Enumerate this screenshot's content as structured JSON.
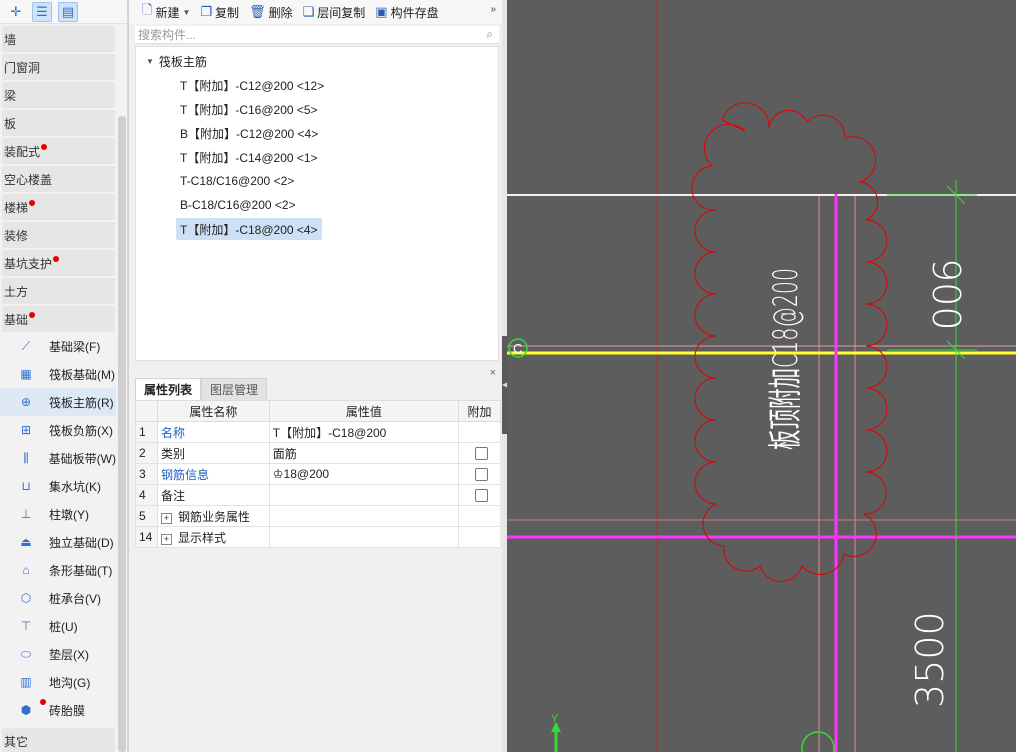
{
  "left_panel": {
    "top_buttons": [
      "cursor-plus-icon",
      "list-view-icon",
      "detail-view-icon"
    ],
    "categories_top": [
      {
        "label": "墙",
        "dot": false
      },
      {
        "label": "门窗洞",
        "dot": false
      },
      {
        "label": "梁",
        "dot": false
      },
      {
        "label": "板",
        "dot": false
      },
      {
        "label": "装配式",
        "dot": true
      },
      {
        "label": "空心楼盖",
        "dot": false
      },
      {
        "label": "楼梯",
        "dot": true
      },
      {
        "label": "装修",
        "dot": false
      },
      {
        "label": "基坑支护",
        "dot": true
      },
      {
        "label": "土方",
        "dot": false
      },
      {
        "label": "基础",
        "dot": true
      }
    ],
    "sub_items": [
      {
        "label": "基础梁(F)",
        "icon": "foundation-beam-icon"
      },
      {
        "label": "筏板基础(M)",
        "icon": "raft-foundation-icon"
      },
      {
        "label": "筏板主筋(R)",
        "icon": "raft-main-rebar-icon"
      },
      {
        "label": "筏板负筋(X)",
        "icon": "raft-negative-rebar-icon"
      },
      {
        "label": "基础板带(W)",
        "icon": "foundation-strip-icon"
      },
      {
        "label": "集水坑(K)",
        "icon": "sump-pit-icon"
      },
      {
        "label": "柱墩(Y)",
        "icon": "column-pier-icon"
      },
      {
        "label": "独立基础(D)",
        "icon": "isolated-footing-icon"
      },
      {
        "label": "条形基础(T)",
        "icon": "strip-footing-icon"
      },
      {
        "label": "桩承台(V)",
        "icon": "pile-cap-icon"
      },
      {
        "label": "桩(U)",
        "icon": "pile-icon"
      },
      {
        "label": "垫层(X)",
        "icon": "cushion-layer-icon"
      },
      {
        "label": "地沟(G)",
        "icon": "trench-icon"
      },
      {
        "label": "砖胎膜",
        "icon": "brick-formwork-icon"
      }
    ],
    "categories_bottom": [
      {
        "label": "其它",
        "dot": false
      }
    ]
  },
  "toolbar": {
    "new_label": "新建",
    "copy_label": "复制",
    "delete_label": "删除",
    "floor_copy_label": "层间复制",
    "save_label": "构件存盘",
    "more": "»"
  },
  "search": {
    "placeholder": "搜索构件..."
  },
  "tree": {
    "root": "筏板主筋",
    "items": [
      "T【附加】-C12@200 <12>",
      "T【附加】-C16@200 <5>",
      "B【附加】-C12@200 <4>",
      "T【附加】-C14@200 <1>",
      "T-C18/C16@200 <2>",
      "B-C18/C16@200 <2>",
      "T【附加】-C18@200 <4>"
    ],
    "selected_index": 6
  },
  "properties": {
    "tabs": [
      "属性列表",
      "图层管理"
    ],
    "headers": [
      "属性名称",
      "属性值",
      "附加"
    ],
    "close": "×",
    "rows": [
      {
        "num": "1",
        "name": "名称",
        "value": "T【附加】-C18@200",
        "checkbox": false,
        "blue": true
      },
      {
        "num": "2",
        "name": "类别",
        "value": "面筋",
        "checkbox": true,
        "blue": false
      },
      {
        "num": "3",
        "name": "钢筋信息",
        "value": "♔18@200",
        "checkbox": true,
        "blue": true
      },
      {
        "num": "4",
        "name": "备注",
        "value": "",
        "checkbox": true,
        "blue": false
      },
      {
        "num": "5",
        "name": "钢筋业务属性",
        "value": "",
        "checkbox": false,
        "blue": false,
        "expander": "+"
      },
      {
        "num": "14",
        "name": "显示样式",
        "value": "",
        "checkbox": false,
        "blue": false,
        "expander": "+"
      }
    ]
  },
  "canvas": {
    "rebar_label": "板顶附加C18@200",
    "dim_upper": "900",
    "dim_lower": "3500",
    "axis_y": "Y",
    "marker": "C"
  }
}
